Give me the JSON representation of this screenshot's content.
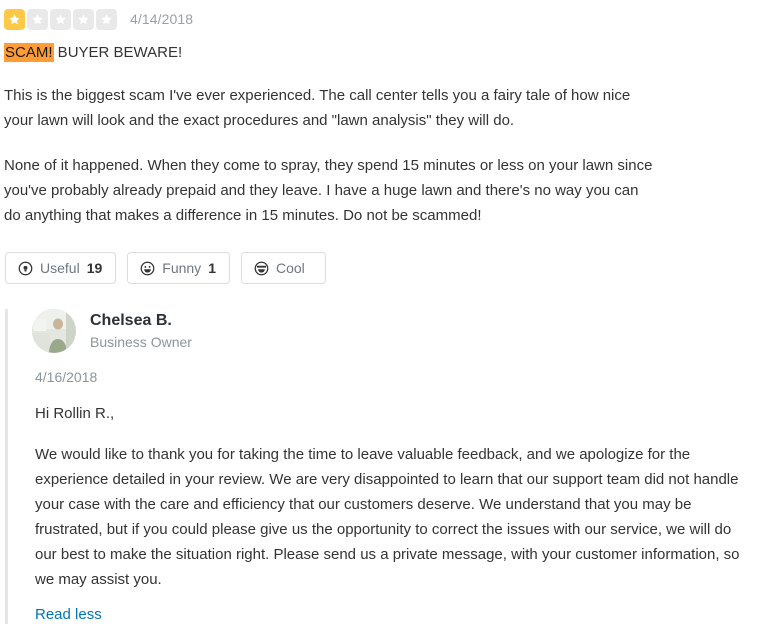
{
  "review": {
    "rating": {
      "value": 1,
      "max": 5,
      "filled_color": "#ffc845",
      "empty_color": "#e9e9e9",
      "star_icon": "star-icon"
    },
    "date": "4/14/2018",
    "title": {
      "highlight": "SCAM!",
      "highlight_color": "#ff9c33",
      "rest": " BUYER BEWARE!"
    },
    "paragraphs": [
      "This is the biggest scam I've ever experienced.  The call center tells you a fairy tale of how nice your lawn will look and the exact procedures and \"lawn analysis\" they will do.",
      "None of it happened.  When they come to spray, they spend 15 minutes or less on your lawn since you've probably already prepaid and they leave.  I have a huge lawn and there's no way you can do anything that makes a difference in 15 minutes.  Do not be scammed!"
    ],
    "votes": [
      {
        "label": "Useful",
        "count": "19",
        "icon": "useful-lightbulb-icon"
      },
      {
        "label": "Funny",
        "count": "1",
        "icon": "funny-smile-icon"
      },
      {
        "label": "Cool",
        "count": "",
        "icon": "cool-sunglasses-icon"
      }
    ]
  },
  "owner_reply": {
    "avatar_icon": "owner-avatar-photo",
    "name": "Chelsea B.",
    "role": "Business Owner",
    "date": "4/16/2018",
    "greeting": "Hi Rollin R.,",
    "body": "We would like to thank you for taking the time to leave valuable feedback, and we apologize for the experience detailed in your review. We are very disappointed to learn that our support team did not handle your case with the care and efficiency that our customers deserve. We understand that you may be frustrated, but if you could please give us the opportunity to correct the issues with our service, we will do our best to make the situation right. Please send us a private message, with your customer information, so we may assist you.",
    "toggle_label": "Read less",
    "link_color": "#0073bb"
  }
}
